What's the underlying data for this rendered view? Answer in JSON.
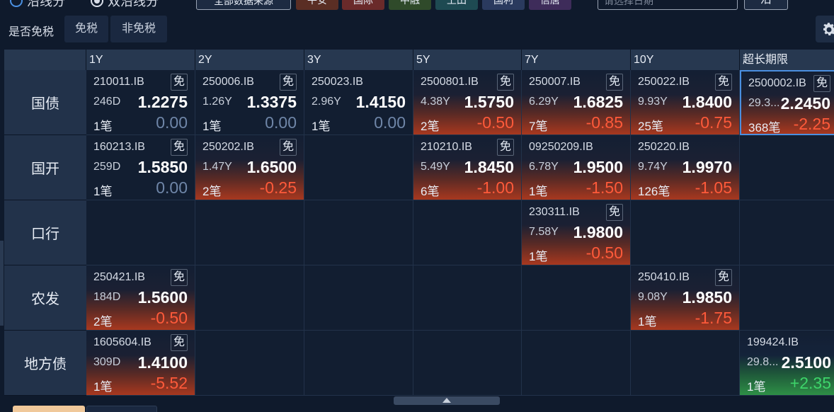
{
  "toolbar": {
    "radio1": "沿线分",
    "radio2": "双沿线分",
    "source_button": "全部数据来源",
    "search_placeholder": "请选择日期",
    "go_button": "沿",
    "brokers": [
      {
        "label": "平安",
        "color": "#5a2e24"
      },
      {
        "label": "国际",
        "color": "#6a2a2a"
      },
      {
        "label": "中融",
        "color": "#2f4a2a"
      },
      {
        "label": "上田",
        "color": "#1e4a52"
      },
      {
        "label": "国利",
        "color": "#2a3a5e"
      },
      {
        "label": "信唐",
        "color": "#3e2c5a"
      }
    ]
  },
  "filter": {
    "label": "是否免税",
    "options": [
      "免税",
      "非免税"
    ]
  },
  "tax_free_badge": "免",
  "columns": [
    "1Y",
    "2Y",
    "3Y",
    "5Y",
    "7Y",
    "10Y",
    "超长期限"
  ],
  "rows": [
    {
      "label": "国债",
      "cells": [
        {
          "code": "210011.IB",
          "free": true,
          "term": "246D",
          "yield": "1.2275",
          "count": "1笔",
          "change": "0.00",
          "style": "zero"
        },
        {
          "code": "250006.IB",
          "free": true,
          "term": "1.26Y",
          "yield": "1.3375",
          "count": "1笔",
          "change": "0.00",
          "style": "zero"
        },
        {
          "code": "250023.IB",
          "free": false,
          "term": "2.96Y",
          "yield": "1.4150",
          "count": "1笔",
          "change": "0.00",
          "style": "zero"
        },
        {
          "code": "2500801.IB",
          "free": true,
          "term": "4.38Y",
          "yield": "1.5750",
          "count": "2笔",
          "change": "-0.50",
          "style": "neg"
        },
        {
          "code": "250007.IB",
          "free": true,
          "term": "6.29Y",
          "yield": "1.6825",
          "count": "7笔",
          "change": "-0.85",
          "style": "neg"
        },
        {
          "code": "250022.IB",
          "free": true,
          "term": "9.93Y",
          "yield": "1.8400",
          "count": "25笔",
          "change": "-0.75",
          "style": "neg"
        },
        {
          "code": "2500002.IB",
          "free": true,
          "term": "29.3...",
          "yield": "2.2450",
          "count": "368笔",
          "change": "-2.25",
          "style": "neg",
          "selected": true
        }
      ]
    },
    {
      "label": "国开",
      "cells": [
        {
          "code": "160213.IB",
          "free": true,
          "term": "259D",
          "yield": "1.5850",
          "count": "1笔",
          "change": "0.00",
          "style": "zero"
        },
        {
          "code": "250202.IB",
          "free": true,
          "term": "1.47Y",
          "yield": "1.6500",
          "count": "2笔",
          "change": "-0.25",
          "style": "neg"
        },
        null,
        {
          "code": "210210.IB",
          "free": true,
          "term": "5.49Y",
          "yield": "1.8450",
          "count": "6笔",
          "change": "-1.00",
          "style": "neg"
        },
        {
          "code": "09250209.IB",
          "free": false,
          "term": "6.78Y",
          "yield": "1.9500",
          "count": "1笔",
          "change": "-1.50",
          "style": "neg"
        },
        {
          "code": "250220.IB",
          "free": false,
          "term": "9.74Y",
          "yield": "1.9970",
          "count": "126笔",
          "change": "-1.05",
          "style": "neg"
        },
        null
      ]
    },
    {
      "label": "口行",
      "cells": [
        null,
        null,
        null,
        null,
        {
          "code": "230311.IB",
          "free": true,
          "term": "7.58Y",
          "yield": "1.9800",
          "count": "1笔",
          "change": "-0.50",
          "style": "neg"
        },
        null,
        null
      ]
    },
    {
      "label": "农发",
      "cells": [
        {
          "code": "250421.IB",
          "free": true,
          "term": "184D",
          "yield": "1.5600",
          "count": "2笔",
          "change": "-0.50",
          "style": "neg"
        },
        null,
        null,
        null,
        null,
        {
          "code": "250410.IB",
          "free": true,
          "term": "9.08Y",
          "yield": "1.9850",
          "count": "1笔",
          "change": "-1.75",
          "style": "neg"
        },
        null
      ]
    },
    {
      "label": "地方债",
      "cells": [
        {
          "code": "1605604.IB",
          "free": true,
          "term": "309D",
          "yield": "1.4100",
          "count": "1笔",
          "change": "-5.52",
          "style": "neg"
        },
        null,
        null,
        null,
        null,
        null,
        {
          "code": "199424.IB",
          "free": false,
          "term": "29.8...",
          "yield": "2.5100",
          "count": "1笔",
          "change": "+2.35",
          "style": "pos"
        }
      ]
    }
  ]
}
